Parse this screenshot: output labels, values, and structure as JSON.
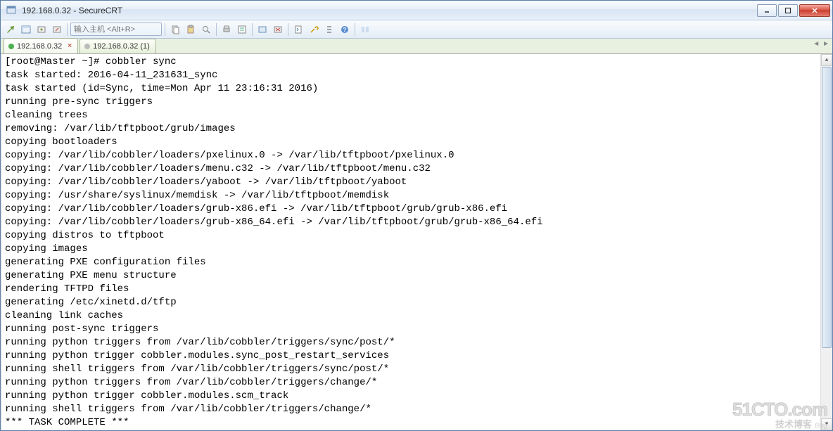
{
  "window": {
    "title": "192.168.0.32 - SecureCRT"
  },
  "toolbar": {
    "host_placeholder": "输入主机 <Alt+R>"
  },
  "tabs": {
    "items": [
      {
        "label": "192.168.0.32",
        "active": true
      },
      {
        "label": "192.168.0.32 (1)",
        "active": false
      }
    ]
  },
  "terminal": {
    "lines": [
      "[root@Master ~]# cobbler sync",
      "task started: 2016-04-11_231631_sync",
      "task started (id=Sync, time=Mon Apr 11 23:16:31 2016)",
      "running pre-sync triggers",
      "cleaning trees",
      "removing: /var/lib/tftpboot/grub/images",
      "copying bootloaders",
      "copying: /var/lib/cobbler/loaders/pxelinux.0 -> /var/lib/tftpboot/pxelinux.0",
      "copying: /var/lib/cobbler/loaders/menu.c32 -> /var/lib/tftpboot/menu.c32",
      "copying: /var/lib/cobbler/loaders/yaboot -> /var/lib/tftpboot/yaboot",
      "copying: /usr/share/syslinux/memdisk -> /var/lib/tftpboot/memdisk",
      "copying: /var/lib/cobbler/loaders/grub-x86.efi -> /var/lib/tftpboot/grub/grub-x86.efi",
      "copying: /var/lib/cobbler/loaders/grub-x86_64.efi -> /var/lib/tftpboot/grub/grub-x86_64.efi",
      "copying distros to tftpboot",
      "copying images",
      "generating PXE configuration files",
      "generating PXE menu structure",
      "rendering TFTPD files",
      "generating /etc/xinetd.d/tftp",
      "cleaning link caches",
      "running post-sync triggers",
      "running python triggers from /var/lib/cobbler/triggers/sync/post/*",
      "running python trigger cobbler.modules.sync_post_restart_services",
      "running shell triggers from /var/lib/cobbler/triggers/sync/post/*",
      "running python triggers from /var/lib/cobbler/triggers/change/*",
      "running python trigger cobbler.modules.scm_track",
      "running shell triggers from /var/lib/cobbler/triggers/change/*",
      "*** TASK COMPLETE ***"
    ]
  },
  "watermark": {
    "line1": "51CTO.com",
    "line2": "技术博客",
    "blog": "Blog"
  }
}
